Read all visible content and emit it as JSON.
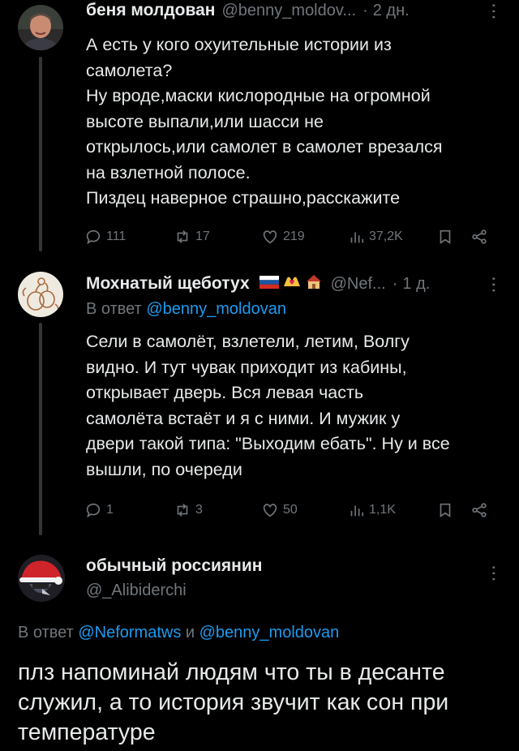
{
  "tweets": [
    {
      "name": "беня молдован",
      "handle": "@benny_moldov...",
      "time": "2 дн.",
      "lines": [
        "А есть у кого охуительные истории из",
        "самолета?",
        "Ну вроде,маски кислородные на огромной",
        "высоте выпали,или шасси не",
        "открылось,или самолет в самолет врезался",
        "на взлетной полосе.",
        "Пиздец наверное страшно,расскажите"
      ],
      "stats": {
        "replies": "111",
        "retweets": "17",
        "likes": "219",
        "views": "37,2K"
      }
    },
    {
      "name": "Мохнатый щеботух",
      "handle": "@Nef...",
      "time": "1 д.",
      "reply_prefix": "В ответ",
      "reply_to": "@benny_moldovan",
      "lines": [
        "Сели в самолёт, взлетели, летим, Волгу",
        "видно.  И тут чувак приходит из кабины,",
        "открывает дверь. Вся левая часть",
        "самолёта встаёт и я с ними. И мужик у",
        "двери такой типа: \"Выходим ебать\". Ну и все",
        "вышли, по очереди"
      ],
      "stats": {
        "replies": "1",
        "retweets": "3",
        "likes": "50",
        "views": "1,1K"
      }
    },
    {
      "name": "обычный россиянин",
      "handle": "@_Alibiderchi",
      "reply_prefix": "В ответ",
      "reply_to_1": "@Neformatws",
      "reply_and": "и",
      "reply_to_2": "@benny_moldovan",
      "lines": [
        "плз напоминай людям что ты в десанте",
        "служил, а то история звучит как сон при",
        "температуре"
      ]
    }
  ],
  "icons": [
    "reply-icon",
    "retweet-icon",
    "like-icon",
    "views-icon",
    "bookmark-icon",
    "share-icon",
    "more-icon"
  ],
  "colors": {
    "background": "#000000",
    "text": "#e7e9ea",
    "muted": "#71767b",
    "link": "#1d9bf0",
    "thread_line": "#333639"
  }
}
